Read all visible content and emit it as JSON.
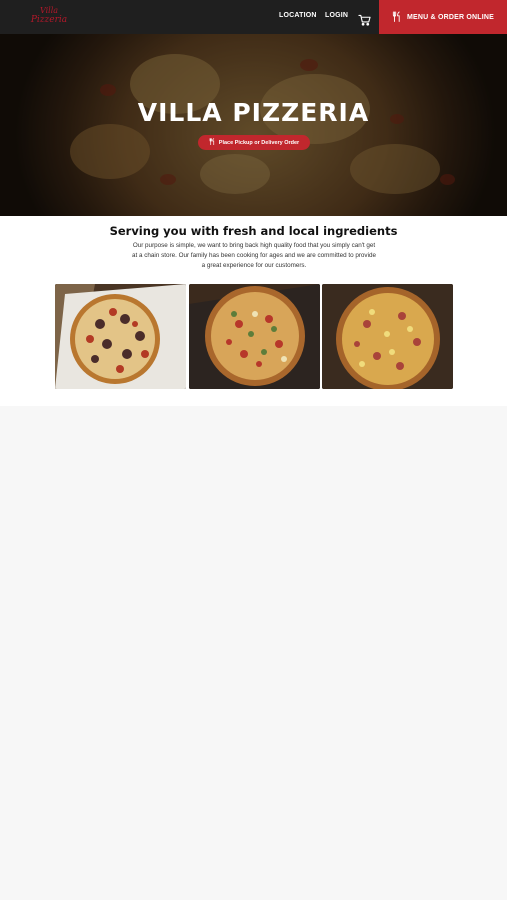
{
  "brand": {
    "logo_line1": "Villa",
    "logo_line2": "Pizzeria",
    "accent_color": "#c1272d"
  },
  "nav": {
    "location": "LOCATION",
    "login": "LOGIN",
    "cart_icon": "cart-icon",
    "order_button": "MENU & ORDER ONLINE",
    "order_icon": "fork-knife-icon"
  },
  "hero": {
    "title": "VILLA PIZZERIA",
    "button": "Place Pickup or Delivery Order",
    "button_icon": "fork-knife-icon"
  },
  "about": {
    "title": "Serving you with fresh and local ingredients",
    "text": "Our purpose is simple, we want to bring back high quality food that you simply can't get at a chain store. Our family has been cooking for ages and we are committed to provide a great experience for our customers."
  },
  "gallery": [
    {
      "name": "pizza-photo-olive-pepperoni"
    },
    {
      "name": "pizza-photo-supreme"
    },
    {
      "name": "pizza-photo-ham-pineapple"
    }
  ]
}
